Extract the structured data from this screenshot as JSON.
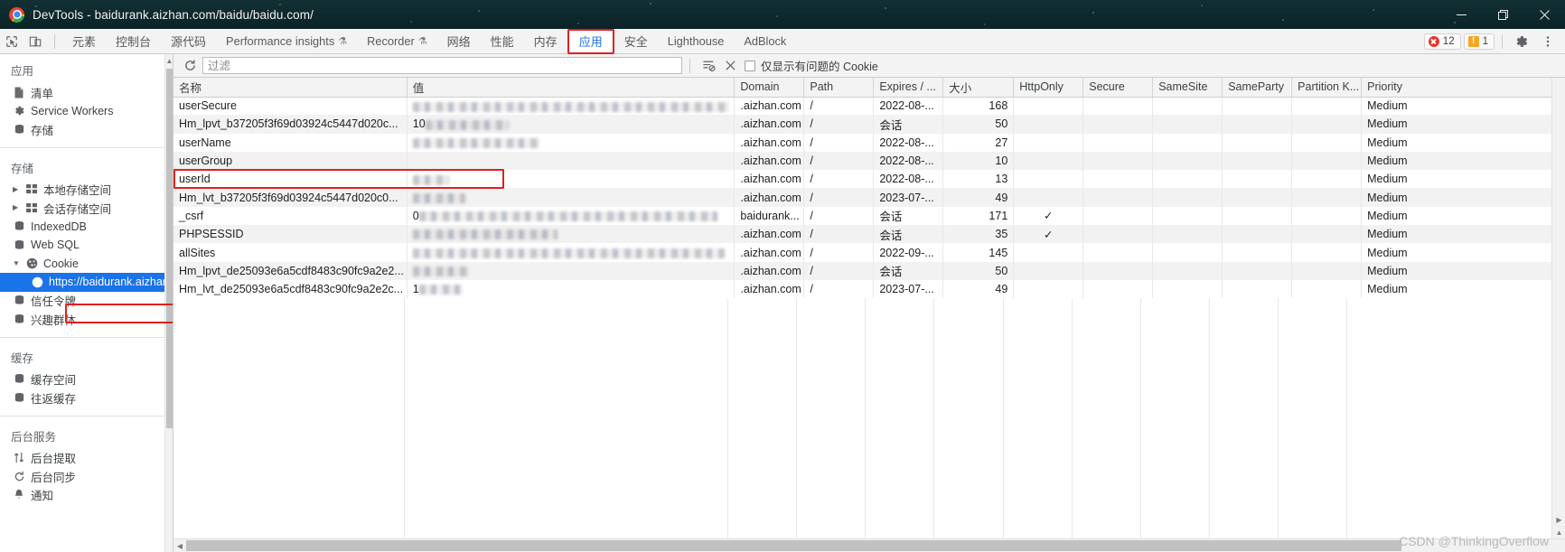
{
  "window": {
    "title": "DevTools - baidurank.aizhan.com/baidu/baidu.com/",
    "logo_icon": "chrome-logo",
    "controls": [
      {
        "name": "minimize-button",
        "icon": "minimize-icon"
      },
      {
        "name": "maximize-button",
        "icon": "restore-icon"
      },
      {
        "name": "close-button",
        "icon": "close-icon"
      }
    ]
  },
  "toolbar": {
    "inspect_icon": "inspect-cursor-icon",
    "device_toggle_icon": "device-toolbar-icon",
    "tabs": [
      {
        "label": "元素",
        "selected": false,
        "experimental": false
      },
      {
        "label": "控制台",
        "selected": false,
        "experimental": false
      },
      {
        "label": "源代码",
        "selected": false,
        "experimental": false
      },
      {
        "label": "Performance insights",
        "selected": false,
        "experimental": true
      },
      {
        "label": "Recorder",
        "selected": false,
        "experimental": true
      },
      {
        "label": "网络",
        "selected": false,
        "experimental": false
      },
      {
        "label": "性能",
        "selected": false,
        "experimental": false
      },
      {
        "label": "内存",
        "selected": false,
        "experimental": false
      },
      {
        "label": "应用",
        "selected": true,
        "experimental": false
      },
      {
        "label": "安全",
        "selected": false,
        "experimental": false
      },
      {
        "label": "Lighthouse",
        "selected": false,
        "experimental": false
      },
      {
        "label": "AdBlock",
        "selected": false,
        "experimental": false
      }
    ],
    "error_count": "12",
    "warning_count": "1",
    "settings_icon": "gear-icon",
    "more_icon": "vertical-dots-icon",
    "highlight_color": "#e02020"
  },
  "sidebar": {
    "groups": [
      {
        "title": "应用",
        "items": [
          {
            "label": "清单",
            "icon": "document-icon",
            "twisty": "",
            "selected": false,
            "child": false
          },
          {
            "label": "Service Workers",
            "icon": "gear-icon",
            "twisty": "",
            "selected": false,
            "child": false
          },
          {
            "label": "存储",
            "icon": "database-icon",
            "twisty": "",
            "selected": false,
            "child": false
          }
        ]
      },
      {
        "title": "存储",
        "items": [
          {
            "label": "本地存储空间",
            "icon": "table-icon",
            "twisty": "▶",
            "selected": false,
            "child": false
          },
          {
            "label": "会话存储空间",
            "icon": "table-icon",
            "twisty": "▶",
            "selected": false,
            "child": false
          },
          {
            "label": "IndexedDB",
            "icon": "database-icon",
            "twisty": "",
            "selected": false,
            "child": false
          },
          {
            "label": "Web SQL",
            "icon": "database-icon",
            "twisty": "",
            "selected": false,
            "child": false
          },
          {
            "label": "Cookie",
            "icon": "cookie-icon",
            "twisty": "▼",
            "selected": false,
            "child": false,
            "highlighted": true
          },
          {
            "label": "https://baidurank.aizhan",
            "icon": "cookie-icon",
            "twisty": "",
            "selected": true,
            "child": true
          },
          {
            "label": "信任令牌",
            "icon": "database-icon",
            "twisty": "",
            "selected": false,
            "child": false
          },
          {
            "label": "兴趣群体",
            "icon": "database-icon",
            "twisty": "",
            "selected": false,
            "child": false
          }
        ]
      },
      {
        "title": "缓存",
        "items": [
          {
            "label": "缓存空间",
            "icon": "database-icon",
            "twisty": "",
            "selected": false,
            "child": false
          },
          {
            "label": "往返缓存",
            "icon": "database-icon",
            "twisty": "",
            "selected": false,
            "child": false
          }
        ]
      },
      {
        "title": "后台服务",
        "items": [
          {
            "label": "后台提取",
            "icon": "arrows-updown-icon",
            "twisty": "",
            "selected": false,
            "child": false
          },
          {
            "label": "后台同步",
            "icon": "refresh-icon",
            "twisty": "",
            "selected": false,
            "child": false
          },
          {
            "label": "通知",
            "icon": "bell-icon",
            "twisty": "",
            "selected": false,
            "child": false
          }
        ]
      }
    ]
  },
  "filterbar": {
    "refresh_icon": "refresh-icon",
    "filter_placeholder": "过滤",
    "filter_value": "",
    "clear_filter_icon": "clear-filter-icon",
    "clear_all_icon": "close-x-icon",
    "checkbox_label": "仅显示有问题的 Cookie",
    "checkbox_checked": false
  },
  "table": {
    "columns": [
      {
        "key": "name",
        "label": "名称"
      },
      {
        "key": "value",
        "label": "值"
      },
      {
        "key": "domain",
        "label": "Domain"
      },
      {
        "key": "path",
        "label": "Path"
      },
      {
        "key": "expires",
        "label": "Expires / ..."
      },
      {
        "key": "size",
        "label": "大小"
      },
      {
        "key": "httponly",
        "label": "HttpOnly"
      },
      {
        "key": "secure",
        "label": "Secure"
      },
      {
        "key": "samesite",
        "label": "SameSite"
      },
      {
        "key": "sameparty",
        "label": "SameParty"
      },
      {
        "key": "partitionkey",
        "label": "Partition K..."
      },
      {
        "key": "priority",
        "label": "Priority"
      }
    ],
    "rows": [
      {
        "name": "userSecure",
        "value_redacted": true,
        "value_prefix": "",
        "value_width": 350,
        "domain": ".aizhan.com",
        "path": "/",
        "expires": "2022-08-...",
        "size": "168",
        "httponly": "",
        "secure": "",
        "samesite": "",
        "sameparty": "",
        "partitionkey": "",
        "priority": "Medium"
      },
      {
        "name": "Hm_lpvt_b37205f3f69d03924c5447d020c...",
        "value_redacted": true,
        "value_prefix": "10",
        "value_width": 92,
        "domain": ".aizhan.com",
        "path": "/",
        "expires": "会话",
        "size": "50",
        "httponly": "",
        "secure": "",
        "samesite": "",
        "sameparty": "",
        "partitionkey": "",
        "priority": "Medium"
      },
      {
        "name": "userName",
        "value_redacted": true,
        "value_prefix": "",
        "value_width": 140,
        "domain": ".aizhan.com",
        "path": "/",
        "expires": "2022-08-...",
        "size": "27",
        "httponly": "",
        "secure": "",
        "samesite": "",
        "sameparty": "",
        "partitionkey": "",
        "priority": "Medium"
      },
      {
        "name": "userGroup",
        "value_redacted": false,
        "value_prefix": "",
        "value_width": 0,
        "domain": ".aizhan.com",
        "path": "/",
        "expires": "2022-08-...",
        "size": "10",
        "httponly": "",
        "secure": "",
        "samesite": "",
        "sameparty": "",
        "partitionkey": "",
        "priority": "Medium"
      },
      {
        "name": "userId",
        "value_redacted": true,
        "value_prefix": "",
        "value_width": 40,
        "domain": ".aizhan.com",
        "path": "/",
        "expires": "2022-08-...",
        "size": "13",
        "httponly": "",
        "secure": "",
        "samesite": "",
        "sameparty": "",
        "partitionkey": "",
        "priority": "Medium",
        "highlighted": true
      },
      {
        "name": "Hm_lvt_b37205f3f69d03924c5447d020c0...",
        "value_redacted": true,
        "value_prefix": "",
        "value_width": 58,
        "domain": ".aizhan.com",
        "path": "/",
        "expires": "2023-07-...",
        "size": "49",
        "httponly": "",
        "secure": "",
        "samesite": "",
        "sameparty": "",
        "partitionkey": "",
        "priority": "Medium"
      },
      {
        "name": "_csrf",
        "value_redacted": true,
        "value_prefix": "0",
        "value_width": 330,
        "domain": "baidurank...",
        "path": "/",
        "expires": "会话",
        "size": "171",
        "httponly": "✓",
        "secure": "",
        "samesite": "",
        "sameparty": "",
        "partitionkey": "",
        "priority": "Medium"
      },
      {
        "name": "PHPSESSID",
        "value_redacted": true,
        "value_prefix": "",
        "value_width": 160,
        "domain": ".aizhan.com",
        "path": "/",
        "expires": "会话",
        "size": "35",
        "httponly": "✓",
        "secure": "",
        "samesite": "",
        "sameparty": "",
        "partitionkey": "",
        "priority": "Medium"
      },
      {
        "name": "allSites",
        "value_redacted": true,
        "value_prefix": "",
        "value_width": 345,
        "domain": ".aizhan.com",
        "path": "/",
        "expires": "2022-09-...",
        "size": "145",
        "httponly": "",
        "secure": "",
        "samesite": "",
        "sameparty": "",
        "partitionkey": "",
        "priority": "Medium"
      },
      {
        "name": "Hm_lpvt_de25093e6a5cdf8483c90fc9a2e2...",
        "value_redacted": true,
        "value_prefix": "",
        "value_width": 62,
        "domain": ".aizhan.com",
        "path": "/",
        "expires": "会话",
        "size": "50",
        "httponly": "",
        "secure": "",
        "samesite": "",
        "sameparty": "",
        "partitionkey": "",
        "priority": "Medium"
      },
      {
        "name": "Hm_lvt_de25093e6a5cdf8483c90fc9a2e2c...",
        "value_redacted": true,
        "value_prefix": "1",
        "value_width": 48,
        "domain": ".aizhan.com",
        "path": "/",
        "expires": "2023-07-...",
        "size": "49",
        "httponly": "",
        "secure": "",
        "samesite": "",
        "sameparty": "",
        "partitionkey": "",
        "priority": "Medium"
      }
    ]
  },
  "watermark": "CSDN @ThinkingOverflow"
}
